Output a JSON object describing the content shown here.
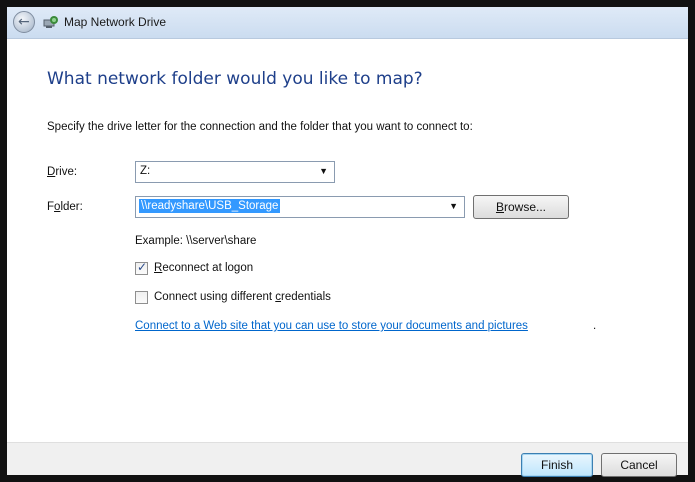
{
  "window": {
    "title": "Map Network Drive"
  },
  "heading": "What network folder would you like to map?",
  "instruction": "Specify the drive letter for the connection and the folder that you want to connect to:",
  "drive": {
    "label_key": "D",
    "label_rest": "rive:",
    "value": "Z:"
  },
  "folder": {
    "label_pre": "F",
    "label_key": "o",
    "label_rest": "lder:",
    "value": "\\\\readyshare\\USB_Storage"
  },
  "browse": {
    "key": "B",
    "rest": "rowse..."
  },
  "example": "Example: \\\\server\\share",
  "reconnect": {
    "checked": true,
    "key": "R",
    "rest": "econnect at logon"
  },
  "credentials": {
    "checked": false,
    "pre": "Connect using different ",
    "key": "c",
    "rest": "redentials"
  },
  "link": {
    "text": "Connect to a Web site that you can use to store your documents and pictures",
    "suffix": "."
  },
  "footer": {
    "finish": "Finish",
    "cancel": "Cancel"
  },
  "icons": {
    "back": "back-arrow-icon",
    "app": "network-drive-icon",
    "dropdown": "chevron-down-icon",
    "check": "checkmark-icon"
  },
  "colors": {
    "heading": "#1e3f8a",
    "link": "#0066cc",
    "selection": "#3399ff"
  }
}
